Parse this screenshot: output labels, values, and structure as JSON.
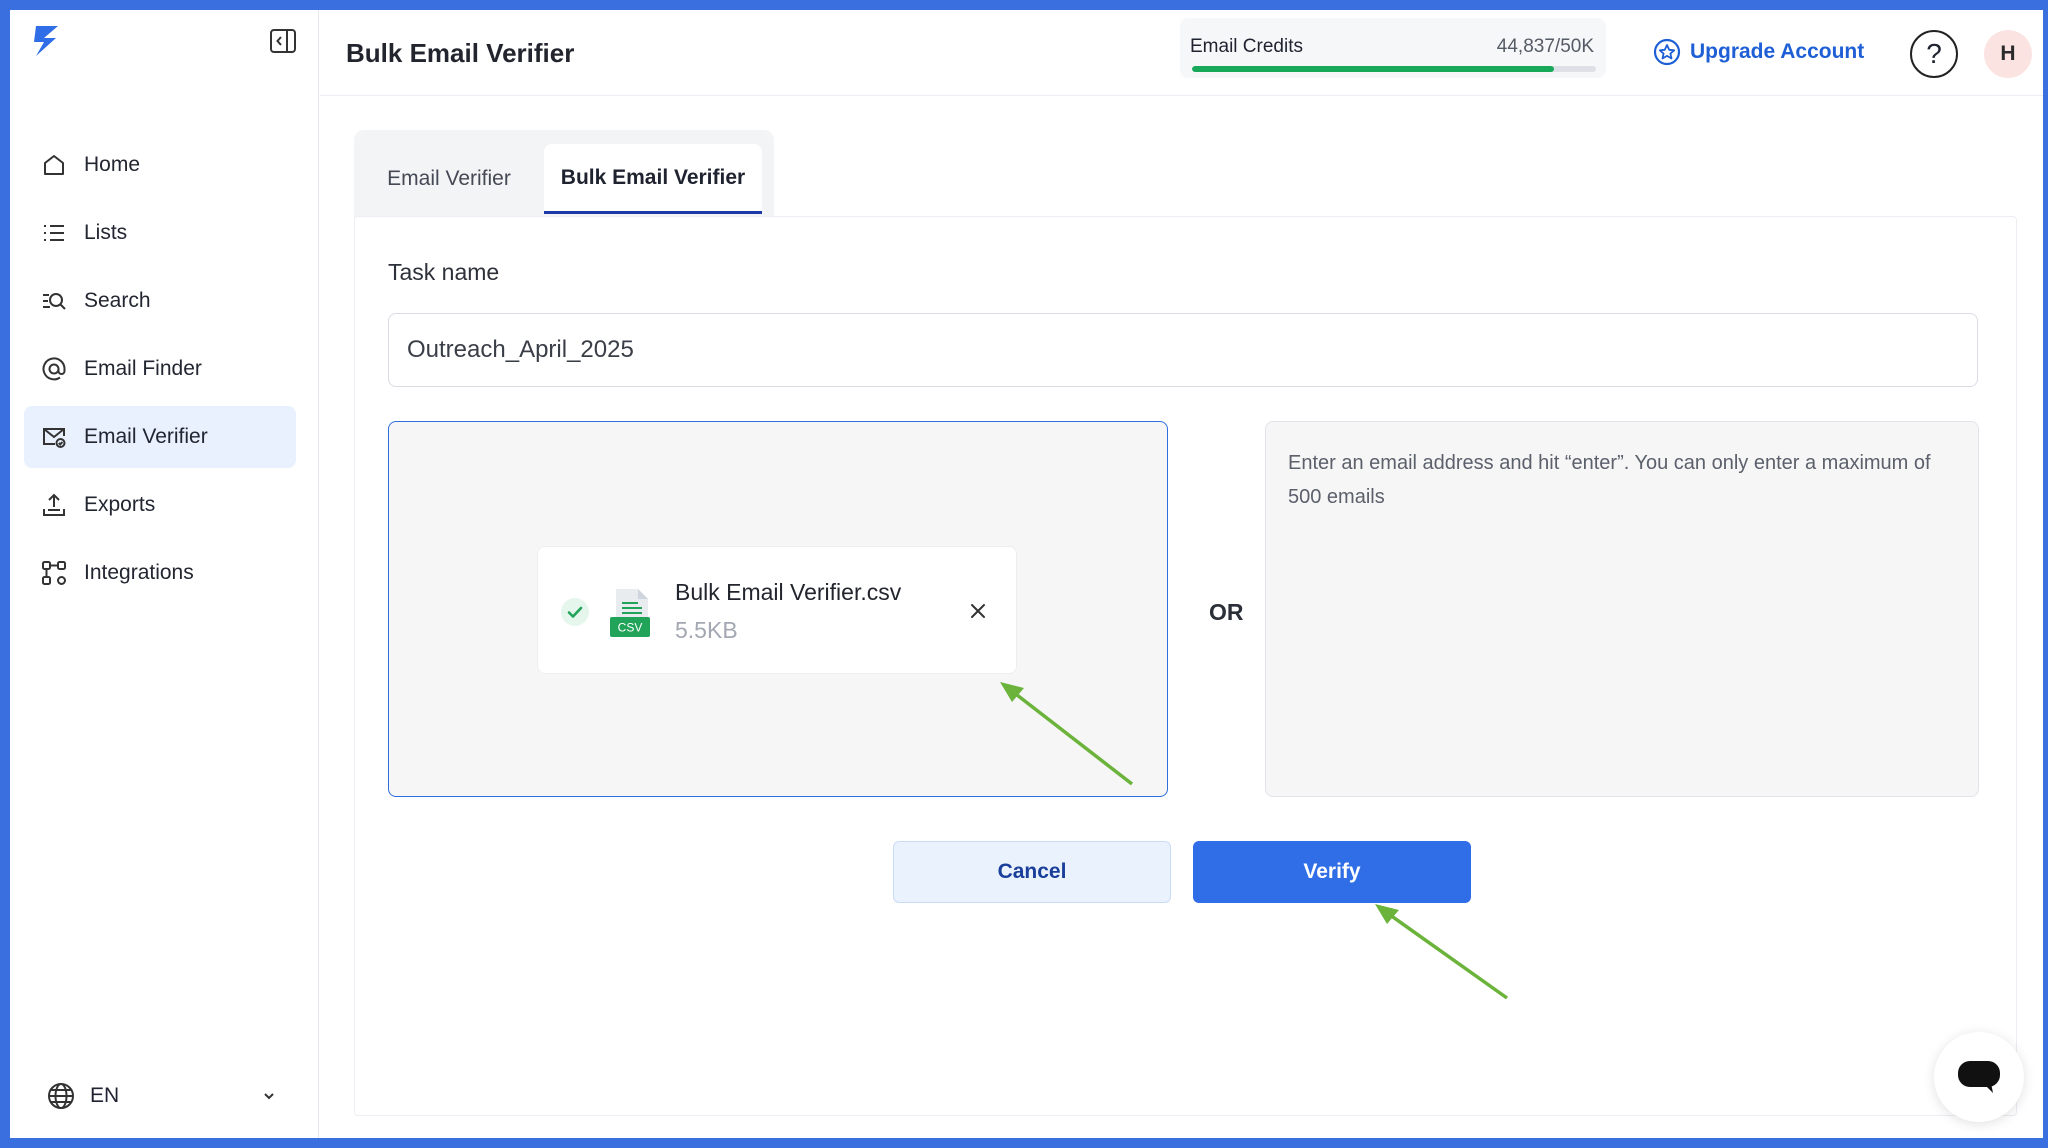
{
  "app": {
    "page_title": "Bulk Email Verifier"
  },
  "sidebar": {
    "items": [
      {
        "label": "Home",
        "icon": "home-icon"
      },
      {
        "label": "Lists",
        "icon": "list-icon"
      },
      {
        "label": "Search",
        "icon": "search-icon"
      },
      {
        "label": "Email Finder",
        "icon": "at-sign-icon"
      },
      {
        "label": "Email Verifier",
        "icon": "mail-check-icon",
        "active": true
      },
      {
        "label": "Exports",
        "icon": "export-icon"
      },
      {
        "label": "Integrations",
        "icon": "integrations-icon"
      }
    ],
    "language": "EN"
  },
  "header": {
    "credits_label": "Email Credits",
    "credits_value": "44,837/50K",
    "credits_fraction": 0.897,
    "upgrade_label": "Upgrade Account",
    "help_label": "?",
    "avatar_initial": "H"
  },
  "tabs": [
    {
      "label": "Email Verifier",
      "active": false
    },
    {
      "label": "Bulk Email Verifier",
      "active": true
    }
  ],
  "form": {
    "task_label": "Task name",
    "task_value": "Outreach_April_2025",
    "file_name": "Bulk Email Verifier.csv",
    "file_size": "5.5KB",
    "file_type_badge": "CSV",
    "or_label": "OR",
    "emails_placeholder": "Enter an email address and hit “enter”. You can only enter a maximum of 500 emails",
    "cancel_label": "Cancel",
    "verify_label": "Verify"
  },
  "colors": {
    "accent": "#2f6ee6",
    "credits_bar": "#18a85a",
    "annotation_arrow": "#6bb33a",
    "frame_border": "#3a6fe0"
  }
}
